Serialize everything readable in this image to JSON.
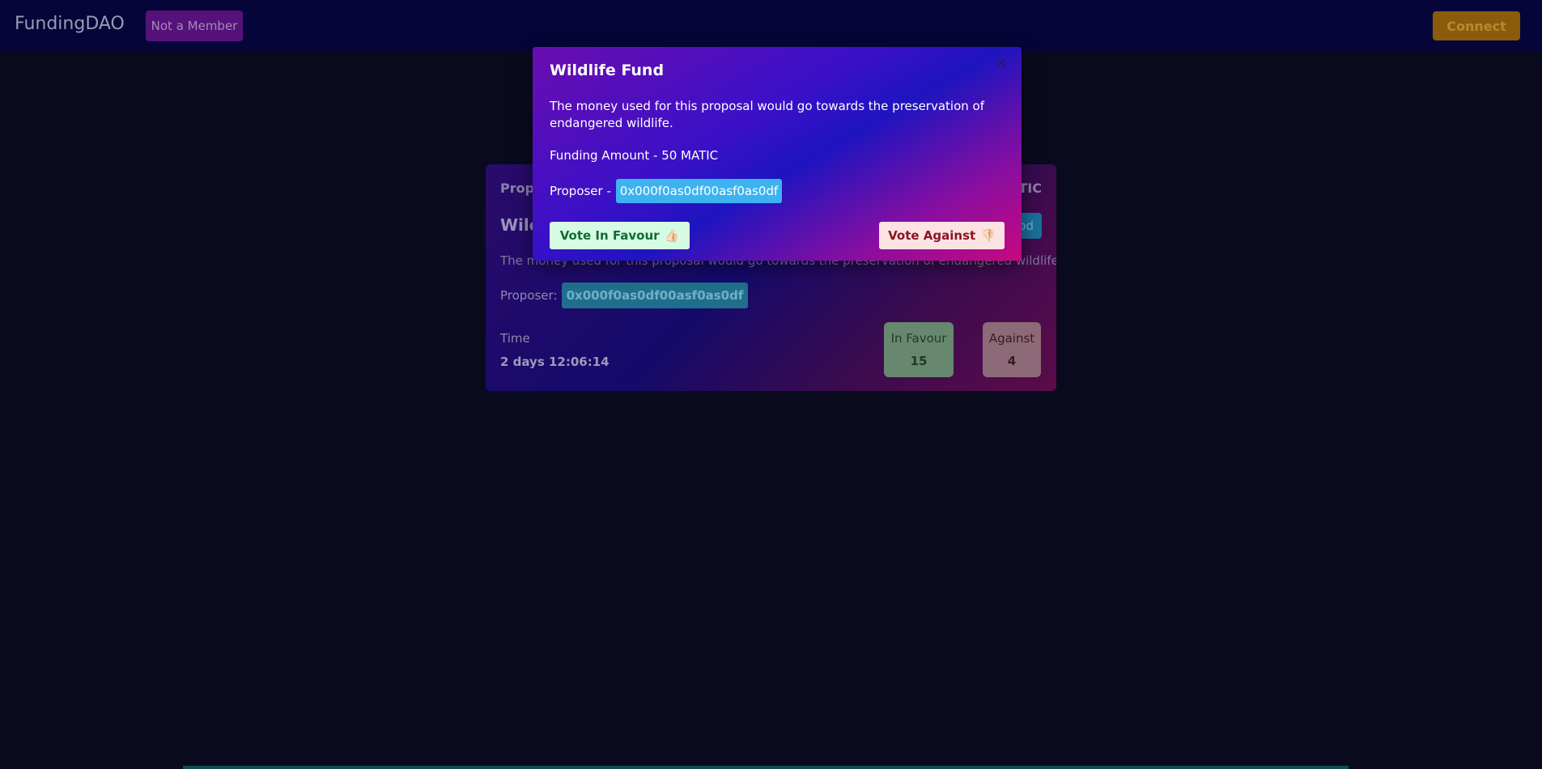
{
  "header": {
    "brand": "FundingDAO",
    "membership_status": "Not a Member",
    "connect_label": "Connect"
  },
  "proposal_card": {
    "label_left": "Propo",
    "label_right": "TIC",
    "title": "Wilc",
    "chip_text": "od",
    "description": "The money used for this proposal would go towards the preservation of endangered wildlife.",
    "proposer_label": "Proposer:",
    "proposer_address": "0x000f0as0df00asf0as0df",
    "time_label": "Time",
    "time_value": "2 days 12:06:14",
    "in_favour_label": "In Favour",
    "in_favour_count": "15",
    "against_label": "Against",
    "against_count": "4"
  },
  "modal": {
    "close_glyph": "×",
    "title": "Wildlife Fund",
    "description": "The money used for this proposal would go towards the preservation of endangered wildlife.",
    "funding_amount": "Funding Amount - 50 MATIC",
    "proposer_label": "Proposer -",
    "proposer_address": "0x000f0as0df00asf0as0df",
    "vote_favour_label": "Vote In Favour",
    "vote_favour_emoji": "👍🏻",
    "vote_against_label": "Vote Against",
    "vote_against_emoji": "👎🏻"
  },
  "colors": {
    "page_background": "#0a0a1f",
    "navbar_background": "#06053a",
    "member_badge": "#55127a",
    "connect_button": "#8a5b0b",
    "proposer_chip": "#3cb3f0",
    "vote_favour_bg": "#d6fbe4",
    "vote_against_bg": "#fde2e4"
  },
  "icons": {
    "close": "close-icon",
    "thumbs_up": "thumbs-up-icon",
    "thumbs_down": "thumbs-down-icon"
  }
}
